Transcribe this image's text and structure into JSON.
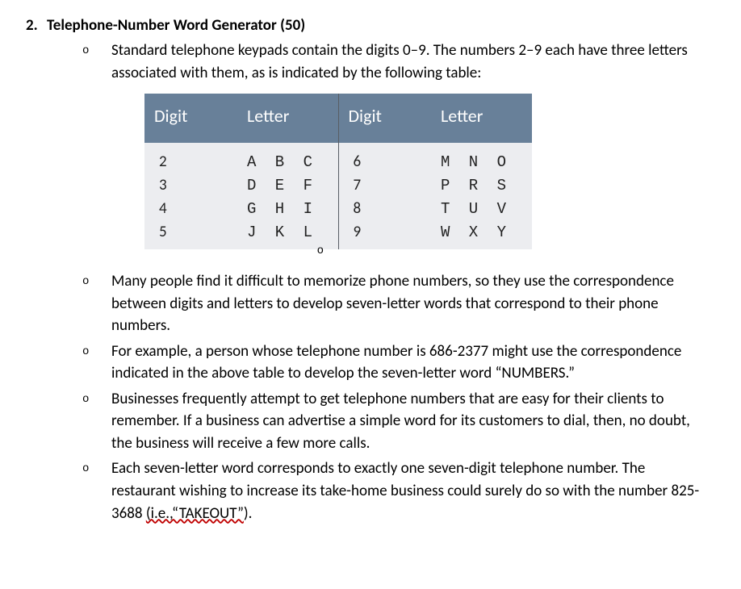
{
  "main": {
    "marker": "2.",
    "title": "Telephone-Number Word Generator (50)"
  },
  "bullets": [
    "Standard telephone keypads contain the digits 0–9. The numbers 2–9 each have three letters associated with them, as is indicated by the following table:",
    "Many people find it difficult to memorize phone numbers, so they use the correspondence between digits and letters to develop seven-letter words that correspond to their phone numbers.",
    "For example, a person whose telephone number is 686-2377 might use the correspondence indicated in the above table to develop the seven-letter word “NUMBERS.”",
    "Businesses frequently attempt to get telephone numbers that are easy for their clients to remember. If a business can advertise a simple word for its customers to dial, then, no doubt, the business will receive a few more calls.",
    "Each seven-letter word corresponds to exactly one seven-digit telephone number. The restaurant wishing to increase its take-home business could surely do so with the number 825-3688 "
  ],
  "last_bullet_spellcheck": "(i.e.,“TAKEOUT”",
  "last_bullet_tail": ").",
  "sub_marker": "o",
  "table": {
    "headers": {
      "digit": "Digit",
      "letter": "Letter"
    },
    "rows_left": [
      {
        "digit": "2",
        "letter": "A B C"
      },
      {
        "digit": "3",
        "letter": "D E F"
      },
      {
        "digit": "4",
        "letter": "G H I"
      },
      {
        "digit": "5",
        "letter": "J K L"
      }
    ],
    "rows_right": [
      {
        "digit": "6",
        "letter": "M N O"
      },
      {
        "digit": "7",
        "letter": "P R S"
      },
      {
        "digit": "8",
        "letter": "T U V"
      },
      {
        "digit": "9",
        "letter": "W X Y"
      }
    ]
  },
  "chart_data": {
    "type": "table",
    "title": "Telephone keypad digit-letter mapping",
    "columns": [
      "Digit",
      "Letter",
      "Digit",
      "Letter"
    ],
    "rows": [
      [
        "2",
        "A B C",
        "6",
        "M N O"
      ],
      [
        "3",
        "D E F",
        "7",
        "P R S"
      ],
      [
        "4",
        "G H I",
        "8",
        "T U V"
      ],
      [
        "5",
        "J K L",
        "9",
        "W X Y"
      ]
    ]
  }
}
